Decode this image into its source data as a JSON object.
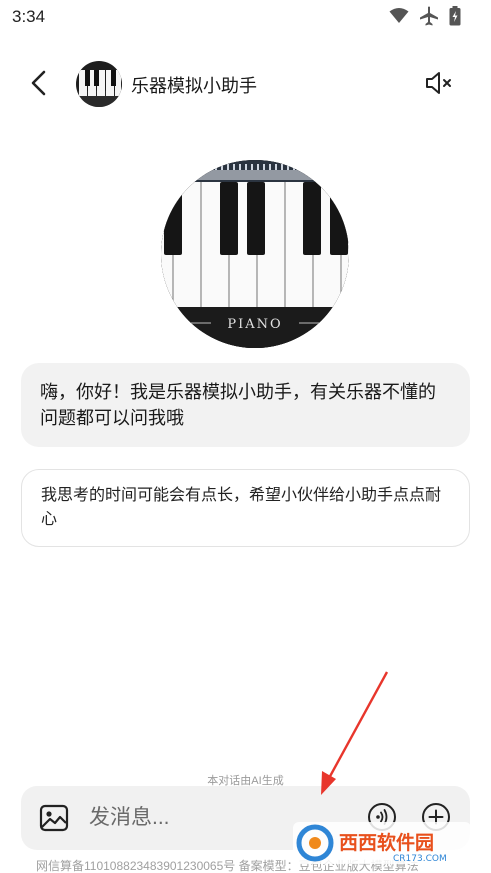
{
  "status_bar": {
    "time": "3:34",
    "icons": [
      "wifi-icon",
      "airplane-icon",
      "battery-icon"
    ]
  },
  "header": {
    "title": "乐器模拟小助手",
    "back_icon": "back-arrow-icon",
    "mute_icon": "speaker-mute-icon"
  },
  "hero": {
    "label": "PIANO"
  },
  "messages": [
    {
      "text": "嗨，你好！我是乐器模拟小助手，有关乐器不懂的问题都可以问我哦"
    },
    {
      "text": "我思考的时间可能会有点长，希望小伙伴给小助手点点耐心"
    }
  ],
  "ai_notice": "本对话由AI生成",
  "input": {
    "placeholder": "发消息...",
    "image_icon": "image-icon",
    "voice_icon": "voice-call-icon",
    "plus_icon": "plus-circle-icon"
  },
  "footer": {
    "text": "网信算备110108823483901230065号 备案模型：豆包企业版大模型算法"
  },
  "watermark": {
    "text": "西西软件园",
    "sub": "CR173.COM"
  },
  "colors": {
    "arrow": "#e8362c",
    "bubble_gray": "#f2f2f2",
    "input_bg": "#f1f1f1"
  }
}
